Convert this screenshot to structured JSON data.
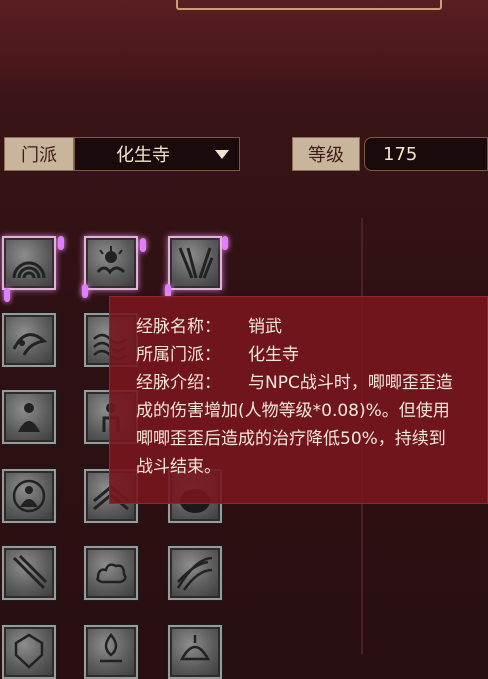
{
  "filters": {
    "sect_label": "门派",
    "sect_value": "化生寺",
    "level_label": "等级",
    "level_value": "175"
  },
  "icons": [
    {
      "name": "rainbow-arch-icon"
    },
    {
      "name": "cloud-sun-icon"
    },
    {
      "name": "split-lines-icon"
    },
    {
      "name": "leaf-swirl-icon"
    },
    {
      "name": "wave-lines-icon"
    },
    {
      "name": "seated-monk-icon"
    },
    {
      "name": "monk-figure-icon"
    },
    {
      "name": "meditating-buddha-icon"
    },
    {
      "name": "stacked-scroll-icon"
    },
    {
      "name": "dark-orb-icon"
    },
    {
      "name": "diagonal-staff-icon"
    },
    {
      "name": "auspicious-cloud-icon"
    },
    {
      "name": "sweeping-wind-icon"
    },
    {
      "name": "warrior-crest-icon"
    },
    {
      "name": "flame-crest-icon"
    },
    {
      "name": "helmet-crest-icon"
    }
  ],
  "tooltip": {
    "name_key": "经脉名称：",
    "name_value": "销武",
    "sect_key": "所属门派：",
    "sect_value": "化生寺",
    "desc_key": "经脉介绍：",
    "desc_line1": "与NPC战斗时，唧唧歪歪造",
    "desc_line2": "成的伤害增加(人物等级*0.08)%。但使用",
    "desc_line3": "唧唧歪歪后造成的治疗降低50%，持续到",
    "desc_line4": "战斗结束。"
  },
  "colors": {
    "panel_bg": "#2a0f12",
    "tooltip_bg": "#78161e",
    "label_bg": "#c9b49c",
    "glow": "#e080ff"
  }
}
